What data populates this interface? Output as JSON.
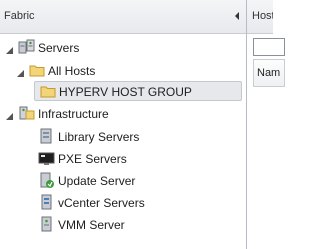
{
  "pane": {
    "title": "Fabric",
    "collapse_glyph": "◂"
  },
  "right_pane": {
    "title": "Host",
    "column_header": "Nam"
  },
  "tree": [
    {
      "key": "servers",
      "label": "Servers",
      "icon": "servers-icon",
      "expanded": true
    },
    {
      "key": "all_hosts",
      "label": "All Hosts",
      "icon": "folder-icon",
      "expanded": true
    },
    {
      "key": "hyperv_group",
      "label": "HYPERV HOST GROUP",
      "icon": "folder-icon",
      "selected": true
    },
    {
      "key": "infrastructure",
      "label": "Infrastructure",
      "icon": "infrastructure-icon",
      "expanded": true
    },
    {
      "key": "library_servers",
      "label": "Library Servers",
      "icon": "library-server-icon"
    },
    {
      "key": "pxe_servers",
      "label": "PXE Servers",
      "icon": "pxe-server-icon"
    },
    {
      "key": "update_server",
      "label": "Update Server",
      "icon": "update-server-icon"
    },
    {
      "key": "vcenter_servers",
      "label": "vCenter Servers",
      "icon": "vcenter-server-icon"
    },
    {
      "key": "vmm_server",
      "label": "VMM Server",
      "icon": "vmm-server-icon"
    }
  ],
  "colors": {
    "selection_bg": "#e6e8ec",
    "folder": "#f2d479",
    "header_bg": "#eceef1"
  }
}
